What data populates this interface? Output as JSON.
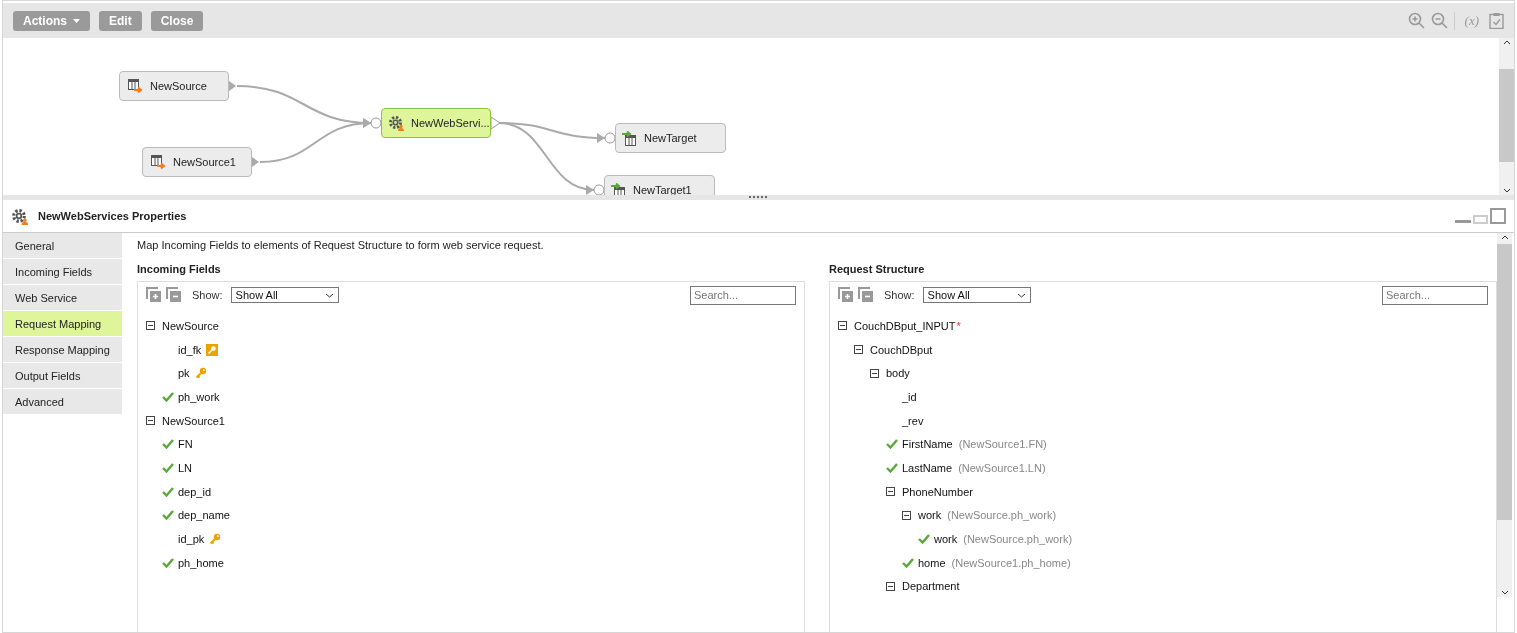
{
  "toolbar": {
    "buttons": [
      {
        "label": "Actions",
        "kind": "menu"
      },
      {
        "label": "Edit",
        "kind": "plain"
      },
      {
        "label": "Close",
        "kind": "plain"
      }
    ],
    "expression_label": "(x)"
  },
  "canvas": {
    "nodes": [
      {
        "label": "NewSource",
        "kind": "source",
        "selected": false
      },
      {
        "label": "NewSource1",
        "kind": "source",
        "selected": false
      },
      {
        "label": "NewWebServi...",
        "kind": "transform",
        "selected": true
      },
      {
        "label": "NewTarget",
        "kind": "target",
        "selected": false
      },
      {
        "label": "NewTarget1",
        "kind": "target",
        "selected": false
      }
    ]
  },
  "properties": {
    "title": "NewWebServices Properties",
    "tabs": [
      {
        "label": "General",
        "selected": false
      },
      {
        "label": "Incoming Fields",
        "selected": false
      },
      {
        "label": "Web Service",
        "selected": false
      },
      {
        "label": "Request Mapping",
        "selected": true
      },
      {
        "label": "Response Mapping",
        "selected": false
      },
      {
        "label": "Output Fields",
        "selected": false
      },
      {
        "label": "Advanced",
        "selected": false
      }
    ],
    "description": "Map Incoming Fields to elements of Request Structure to form web service request.",
    "panels": [
      {
        "title": "Incoming Fields",
        "show_label": "Show:",
        "show_value": "Show All",
        "search_placeholder": "Search...",
        "tree": [
          {
            "label": "NewSource",
            "expanded": true,
            "children": [
              {
                "label": "id_fk",
                "mapped": false,
                "kind": "foreign_key"
              },
              {
                "label": "pk",
                "mapped": false,
                "kind": "primary_key"
              },
              {
                "label": "ph_work",
                "mapped": true
              }
            ]
          },
          {
            "label": "NewSource1",
            "expanded": true,
            "children": [
              {
                "label": "FN",
                "mapped": true
              },
              {
                "label": "LN",
                "mapped": true
              },
              {
                "label": "dep_id",
                "mapped": true
              },
              {
                "label": "dep_name",
                "mapped": true
              },
              {
                "label": "id_pk",
                "mapped": false,
                "kind": "primary_key"
              },
              {
                "label": "ph_home",
                "mapped": true
              }
            ]
          }
        ]
      },
      {
        "title": "Request Structure",
        "show_label": "Show:",
        "show_value": "Show All",
        "search_placeholder": "Search...",
        "tree": [
          {
            "label": "CouchDBput_INPUT",
            "required_mark": "*",
            "expanded": true,
            "children": [
              {
                "label": "CouchDBput",
                "expanded": true,
                "children": [
                  {
                    "label": "body",
                    "expanded": true,
                    "children": [
                      {
                        "label": "_id",
                        "mapped": false
                      },
                      {
                        "label": "_rev",
                        "mapped": false
                      },
                      {
                        "label": "FirstName",
                        "mapped": true,
                        "source": "(NewSource1.FN)"
                      },
                      {
                        "label": "LastName",
                        "mapped": true,
                        "source": "(NewSource1.LN)"
                      },
                      {
                        "label": "PhoneNumber",
                        "expanded": true,
                        "children": [
                          {
                            "label": "work",
                            "expanded": true,
                            "source": "(NewSource.ph_work)",
                            "children": [
                              {
                                "label": "work",
                                "mapped": true,
                                "source": "(NewSource.ph_work)"
                              }
                            ]
                          },
                          {
                            "label": "home",
                            "mapped": true,
                            "source": "(NewSource1.ph_home)"
                          }
                        ]
                      },
                      {
                        "label": "Department",
                        "expanded": true
                      }
                    ]
                  }
                ]
              }
            ]
          }
        ]
      }
    ]
  }
}
